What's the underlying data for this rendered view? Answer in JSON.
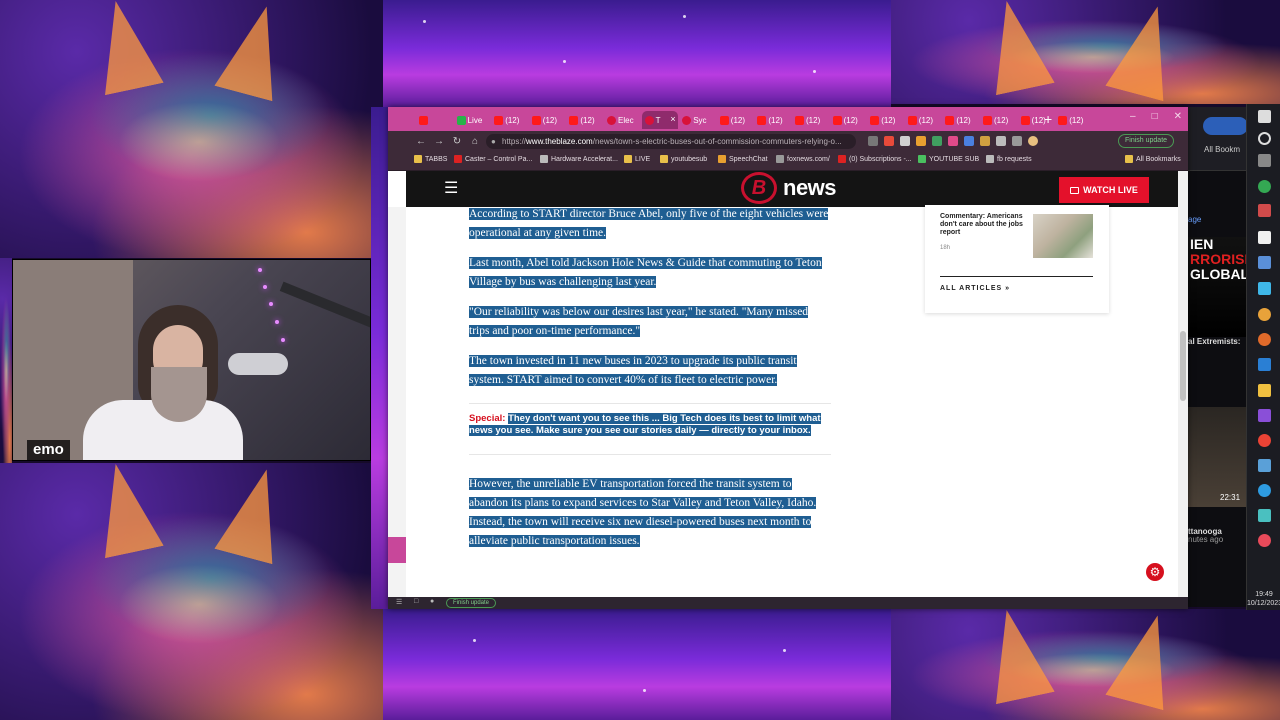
{
  "webcam": {
    "label": "emo"
  },
  "browser": {
    "tabs": [
      {
        "label": "",
        "favicon": "youtube-red"
      },
      {
        "label": "Live",
        "favicon": "green"
      },
      {
        "label": "(12)",
        "favicon": "youtube-red"
      },
      {
        "label": "(12)",
        "favicon": "youtube-red"
      },
      {
        "label": "(12)",
        "favicon": "youtube-red"
      },
      {
        "label": "Elec",
        "favicon": "blaze"
      },
      {
        "label": "T",
        "favicon": "blaze",
        "active": true
      },
      {
        "label": "Syc",
        "favicon": "blaze"
      },
      {
        "label": "(12)",
        "favicon": "youtube-red"
      },
      {
        "label": "(12)",
        "favicon": "youtube-red"
      },
      {
        "label": "(12)",
        "favicon": "youtube-red"
      },
      {
        "label": "(12)",
        "favicon": "youtube-red"
      },
      {
        "label": "(12)",
        "favicon": "youtube-red"
      },
      {
        "label": "(12)",
        "favicon": "youtube-red"
      },
      {
        "label": "(12)",
        "favicon": "youtube-red"
      },
      {
        "label": "(12)",
        "favicon": "youtube-red"
      },
      {
        "label": "(12)",
        "favicon": "youtube-red"
      },
      {
        "label": "(12)",
        "favicon": "youtube-red"
      }
    ],
    "new_tab": "+",
    "url_prefix": "https://",
    "url_host": "www.theblaze.com",
    "url_path": "/news/town-s-electric-buses-out-of-commission-commuters-relying-o...",
    "finish_update": "Finish update",
    "bookmarks": [
      {
        "label": "TABBS"
      },
      {
        "label": "Caster – Control Pa..."
      },
      {
        "label": "Hardware Accelerat..."
      },
      {
        "label": "LIVE"
      },
      {
        "label": "youtubesub"
      },
      {
        "label": "SpeechChat"
      },
      {
        "label": "foxnews.com/"
      },
      {
        "label": "(0) Subscriptions -..."
      },
      {
        "label": "YOUTUBE SUB"
      },
      {
        "label": "fb requests"
      },
      {
        "label": "All Bookmarks"
      }
    ]
  },
  "site": {
    "logo_letter": "B",
    "logo_text": "news",
    "watch_live": "WATCH LIVE",
    "article": {
      "paragraphs": [
        "According to START director Bruce Abel, only five of the eight vehicles were operational at any given time.",
        "Last month, Abel told Jackson Hole News & Guide that commuting to Teton Village by bus was challenging last year.",
        "\"Our reliability was below our desires last year,\" he stated. \"Many missed trips and poor on-time performance.\"",
        "The town invested in 11 new buses in 2023 to upgrade its public transit system. START aimed to convert 40% of its fleet to electric power."
      ],
      "special_label": "Special:",
      "special_text": "They don't want you to see this ... Big Tech does its best to limit what news you see. Make sure you see our stories daily — directly to your inbox.",
      "paragraph_after": "However, the unreliable EV transportation forced the transit system to abandon its plans to expand services to Star Valley and Teton Valley, Idaho. Instead, the town will receive six new diesel-powered buses next month to alleviate public transportation issues."
    },
    "sidebar": {
      "card_title": "Commentary: Americans don't care about the jobs report",
      "card_time": "18h",
      "all_articles": "ALL ARTICLES"
    }
  },
  "desktop": {
    "all_bookmarks": "All Bookm",
    "image_lines": [
      "IEN",
      "RRORISM",
      "GLOBAL"
    ],
    "extremists": "al Extremists:",
    "time_small": "22:31",
    "place": "ttanooga",
    "ago": "nutes ago",
    "sage": "age"
  },
  "taskbar": {
    "time": "19:49",
    "date": "10/12/2023"
  },
  "statusbar": {
    "finish_update": "Finish update"
  }
}
